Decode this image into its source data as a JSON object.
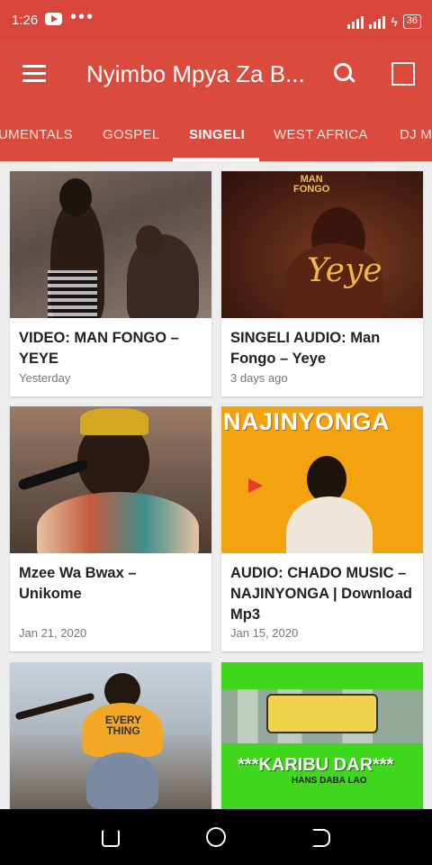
{
  "status": {
    "time": "1:26",
    "battery": "36"
  },
  "toolbar": {
    "title": "Nyimbo Mpya Za B..."
  },
  "tabs": [
    {
      "label": "UMENTALS"
    },
    {
      "label": "GOSPEL"
    },
    {
      "label": "SINGELI"
    },
    {
      "label": "WEST AFRICA"
    },
    {
      "label": "DJ M"
    }
  ],
  "cards": [
    {
      "title": "VIDEO: MAN FONGO – YEYE",
      "date": "Yesterday"
    },
    {
      "title": "SINGELI AUDIO: Man Fongo – Yeye",
      "date": "3 days ago"
    },
    {
      "title": "Mzee Wa Bwax – Unikome",
      "date": "Jan 21, 2020"
    },
    {
      "title": "AUDIO: CHADO MUSIC – NAJINYONGA | Download Mp3",
      "date": "Jan 15, 2020"
    },
    {
      "title": "",
      "date": ""
    },
    {
      "title": "",
      "date": ""
    }
  ],
  "covers": {
    "man_fongo": "MAN\nFONGO",
    "yeye": "Yeye",
    "najinyonga": "NAJINYONGA",
    "every_thing": "EVERY THING",
    "karibu_dar": "***KARIBU DAR***",
    "hans_daba": "HANS DABA LAO"
  },
  "colors": {
    "primary": "#da4a3d",
    "statusbar": "#d8463c",
    "background": "#ededed"
  }
}
